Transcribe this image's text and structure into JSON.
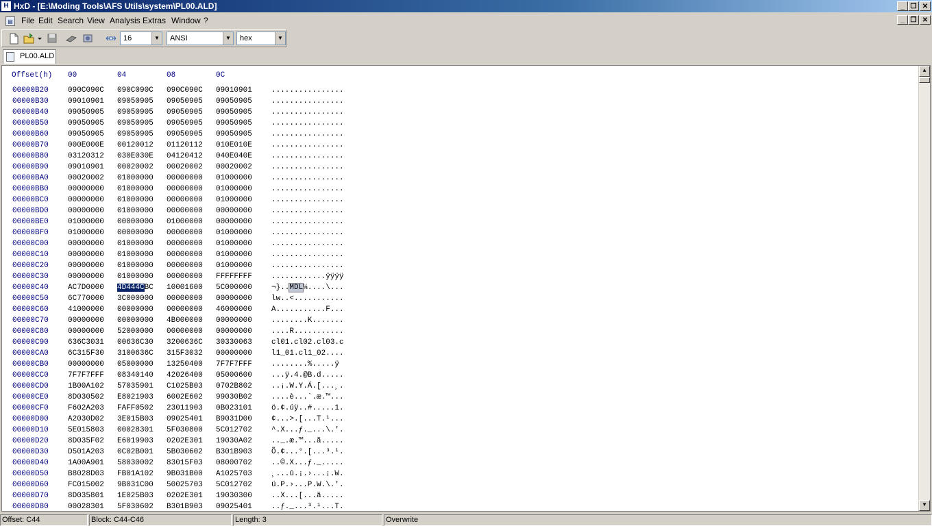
{
  "window": {
    "title": "HxD - [E:\\Moding Tools\\AFS Utils\\system\\PL00.ALD]",
    "app_icon": "hxd-app-icon",
    "buttons": {
      "minimize": "_",
      "restore": "❐",
      "close": "✕"
    }
  },
  "menu": {
    "items": [
      "File",
      "Edit",
      "Search",
      "View",
      "Analysis",
      "Extras",
      "Window",
      "?"
    ],
    "mdi_buttons": {
      "minimize": "_",
      "restore": "❐",
      "close": "✕"
    }
  },
  "toolbar": {
    "bytes_per_row": "16",
    "charset": "ANSI",
    "offset_base": "hex",
    "icons": [
      "new-file-icon",
      "open-file-icon",
      "save-icon",
      "ram-icon",
      "disk-icon",
      "bytes-per-row-icon"
    ]
  },
  "tabs": [
    {
      "label": "PL00.ALD"
    }
  ],
  "hex": {
    "header": {
      "offset": "Offset(h)",
      "c0": "00",
      "c1": "04",
      "c2": "08",
      "c3": "0C"
    },
    "rows": [
      {
        "off": "00000B20",
        "c": [
          "090C090C",
          "090C090C",
          "090C090C",
          "09010901"
        ],
        "a": "................"
      },
      {
        "off": "00000B30",
        "c": [
          "09010901",
          "09050905",
          "09050905",
          "09050905"
        ],
        "a": "................"
      },
      {
        "off": "00000B40",
        "c": [
          "09050905",
          "09050905",
          "09050905",
          "09050905"
        ],
        "a": "................"
      },
      {
        "off": "00000B50",
        "c": [
          "09050905",
          "09050905",
          "09050905",
          "09050905"
        ],
        "a": "................"
      },
      {
        "off": "00000B60",
        "c": [
          "09050905",
          "09050905",
          "09050905",
          "09050905"
        ],
        "a": "................"
      },
      {
        "off": "00000B70",
        "c": [
          "000E000E",
          "00120012",
          "01120112",
          "010E010E"
        ],
        "a": "................"
      },
      {
        "off": "00000B80",
        "c": [
          "03120312",
          "030E030E",
          "04120412",
          "040E040E"
        ],
        "a": "................"
      },
      {
        "off": "00000B90",
        "c": [
          "09010901",
          "00020002",
          "00020002",
          "00020002"
        ],
        "a": "................"
      },
      {
        "off": "00000BA0",
        "c": [
          "00020002",
          "01000000",
          "00000000",
          "01000000"
        ],
        "a": "................"
      },
      {
        "off": "00000BB0",
        "c": [
          "00000000",
          "01000000",
          "00000000",
          "01000000"
        ],
        "a": "................"
      },
      {
        "off": "00000BC0",
        "c": [
          "00000000",
          "01000000",
          "00000000",
          "01000000"
        ],
        "a": "................"
      },
      {
        "off": "00000BD0",
        "c": [
          "00000000",
          "01000000",
          "00000000",
          "00000000"
        ],
        "a": "................"
      },
      {
        "off": "00000BE0",
        "c": [
          "01000000",
          "00000000",
          "01000000",
          "00000000"
        ],
        "a": "................"
      },
      {
        "off": "00000BF0",
        "c": [
          "01000000",
          "00000000",
          "00000000",
          "01000000"
        ],
        "a": "................"
      },
      {
        "off": "00000C00",
        "c": [
          "00000000",
          "01000000",
          "00000000",
          "01000000"
        ],
        "a": "................"
      },
      {
        "off": "00000C10",
        "c": [
          "00000000",
          "01000000",
          "00000000",
          "01000000"
        ],
        "a": "................"
      },
      {
        "off": "00000C20",
        "c": [
          "00000000",
          "01000000",
          "00000000",
          "01000000"
        ],
        "a": "................"
      },
      {
        "off": "00000C30",
        "c": [
          "00000000",
          "01000000",
          "00000000",
          "FFFFFFFF"
        ],
        "a": "............ÿÿÿÿ"
      },
      {
        "off": "00000C40",
        "c": [
          "AC7D0000",
          "",
          "10001600",
          "5C000000"
        ],
        "a": "",
        "sel": true,
        "c1_sel": "4D444C",
        "c1_rest": "BC",
        "a_pre": "¬}..",
        "a_sel": "MDL",
        "a_post": "¼....\\..."
      },
      {
        "off": "00000C50",
        "c": [
          "6C770000",
          "3C000000",
          "00000000",
          "00000000"
        ],
        "a": "lw..<..........."
      },
      {
        "off": "00000C60",
        "c": [
          "41000000",
          "00000000",
          "00000000",
          "46000000"
        ],
        "a": "A...........F..."
      },
      {
        "off": "00000C70",
        "c": [
          "00000000",
          "00000000",
          "4B000000",
          "00000000"
        ],
        "a": "........K......."
      },
      {
        "off": "00000C80",
        "c": [
          "00000000",
          "52000000",
          "00000000",
          "00000000"
        ],
        "a": "....R..........."
      },
      {
        "off": "00000C90",
        "c": [
          "636C3031",
          "00636C30",
          "3200636C",
          "30330063"
        ],
        "a": "cl01.cl02.cl03.c"
      },
      {
        "off": "00000CA0",
        "c": [
          "6C315F30",
          "3100636C",
          "315F3032",
          "00000000"
        ],
        "a": "l1_01.cl1_02...."
      },
      {
        "off": "00000CB0",
        "c": [
          "00000000",
          "05000000",
          "13250400",
          "7F7F7FFF"
        ],
        "a": "........%.....ÿ"
      },
      {
        "off": "00000CC0",
        "c": [
          "7F7F7FFF",
          "08340140",
          "42026400",
          "05000600"
        ],
        "a": "...ÿ.4.@B.d....."
      },
      {
        "off": "00000CD0",
        "c": [
          "1B00A102",
          "57035901",
          "C1025B03",
          "0702B802"
        ],
        "a": "..¡.W.Y.Á.[...¸."
      },
      {
        "off": "00000CE0",
        "c": [
          "8D030502",
          "E8021903",
          "6002E602",
          "99030B02"
        ],
        "a": "....è...`.æ.™..."
      },
      {
        "off": "00000CF0",
        "c": [
          "F602A203",
          "FAFF0502",
          "23011903",
          "0B023101"
        ],
        "a": "ö.¢.úÿ..#.....1."
      },
      {
        "off": "00000D00",
        "c": [
          "A2030D02",
          "3E015B03",
          "09025401",
          "B9031D00"
        ],
        "a": "¢...>.[...T.¹..."
      },
      {
        "off": "00000D10",
        "c": [
          "5E015803",
          "00028301",
          "5F030800",
          "5C012702"
        ],
        "a": "^.X...ƒ._...\\.'."
      },
      {
        "off": "00000D20",
        "c": [
          "8D035F02",
          "E6019903",
          "0202E301",
          "19030A02"
        ],
        "a": ".._.æ.™...ã....."
      },
      {
        "off": "00000D30",
        "c": [
          "D501A203",
          "0C02B001",
          "5B030602",
          "B301B903"
        ],
        "a": "Õ.¢...°.[...³.¹."
      },
      {
        "off": "00000D40",
        "c": [
          "1A00A901",
          "58030002",
          "83015F03",
          "08000702"
        ],
        "a": "..©.X...ƒ._....."
      },
      {
        "off": "00000D50",
        "c": [
          "B8028D03",
          "FB01A102",
          "9B031B00",
          "A1025703"
        ],
        "a": "¸...û.¡.›...¡.W."
      },
      {
        "off": "00000D60",
        "c": [
          "FC015002",
          "9B031C00",
          "50025703",
          "5C012702"
        ],
        "a": "ü.P.›...P.W.\\.'."
      },
      {
        "off": "00000D70",
        "c": [
          "8D035801",
          "1E025B03",
          "0202E301",
          "19030300"
        ],
        "a": "..X...[...ã....."
      },
      {
        "off": "00000D80",
        "c": [
          "00028301",
          "5F030602",
          "B301B903",
          "09025401"
        ],
        "a": "..ƒ._...³.¹...T."
      }
    ]
  },
  "status": {
    "offset": "Offset: C44",
    "block": "Block: C44-C46",
    "length": "Length: 3",
    "empty": "",
    "mode": "Overwrite"
  }
}
